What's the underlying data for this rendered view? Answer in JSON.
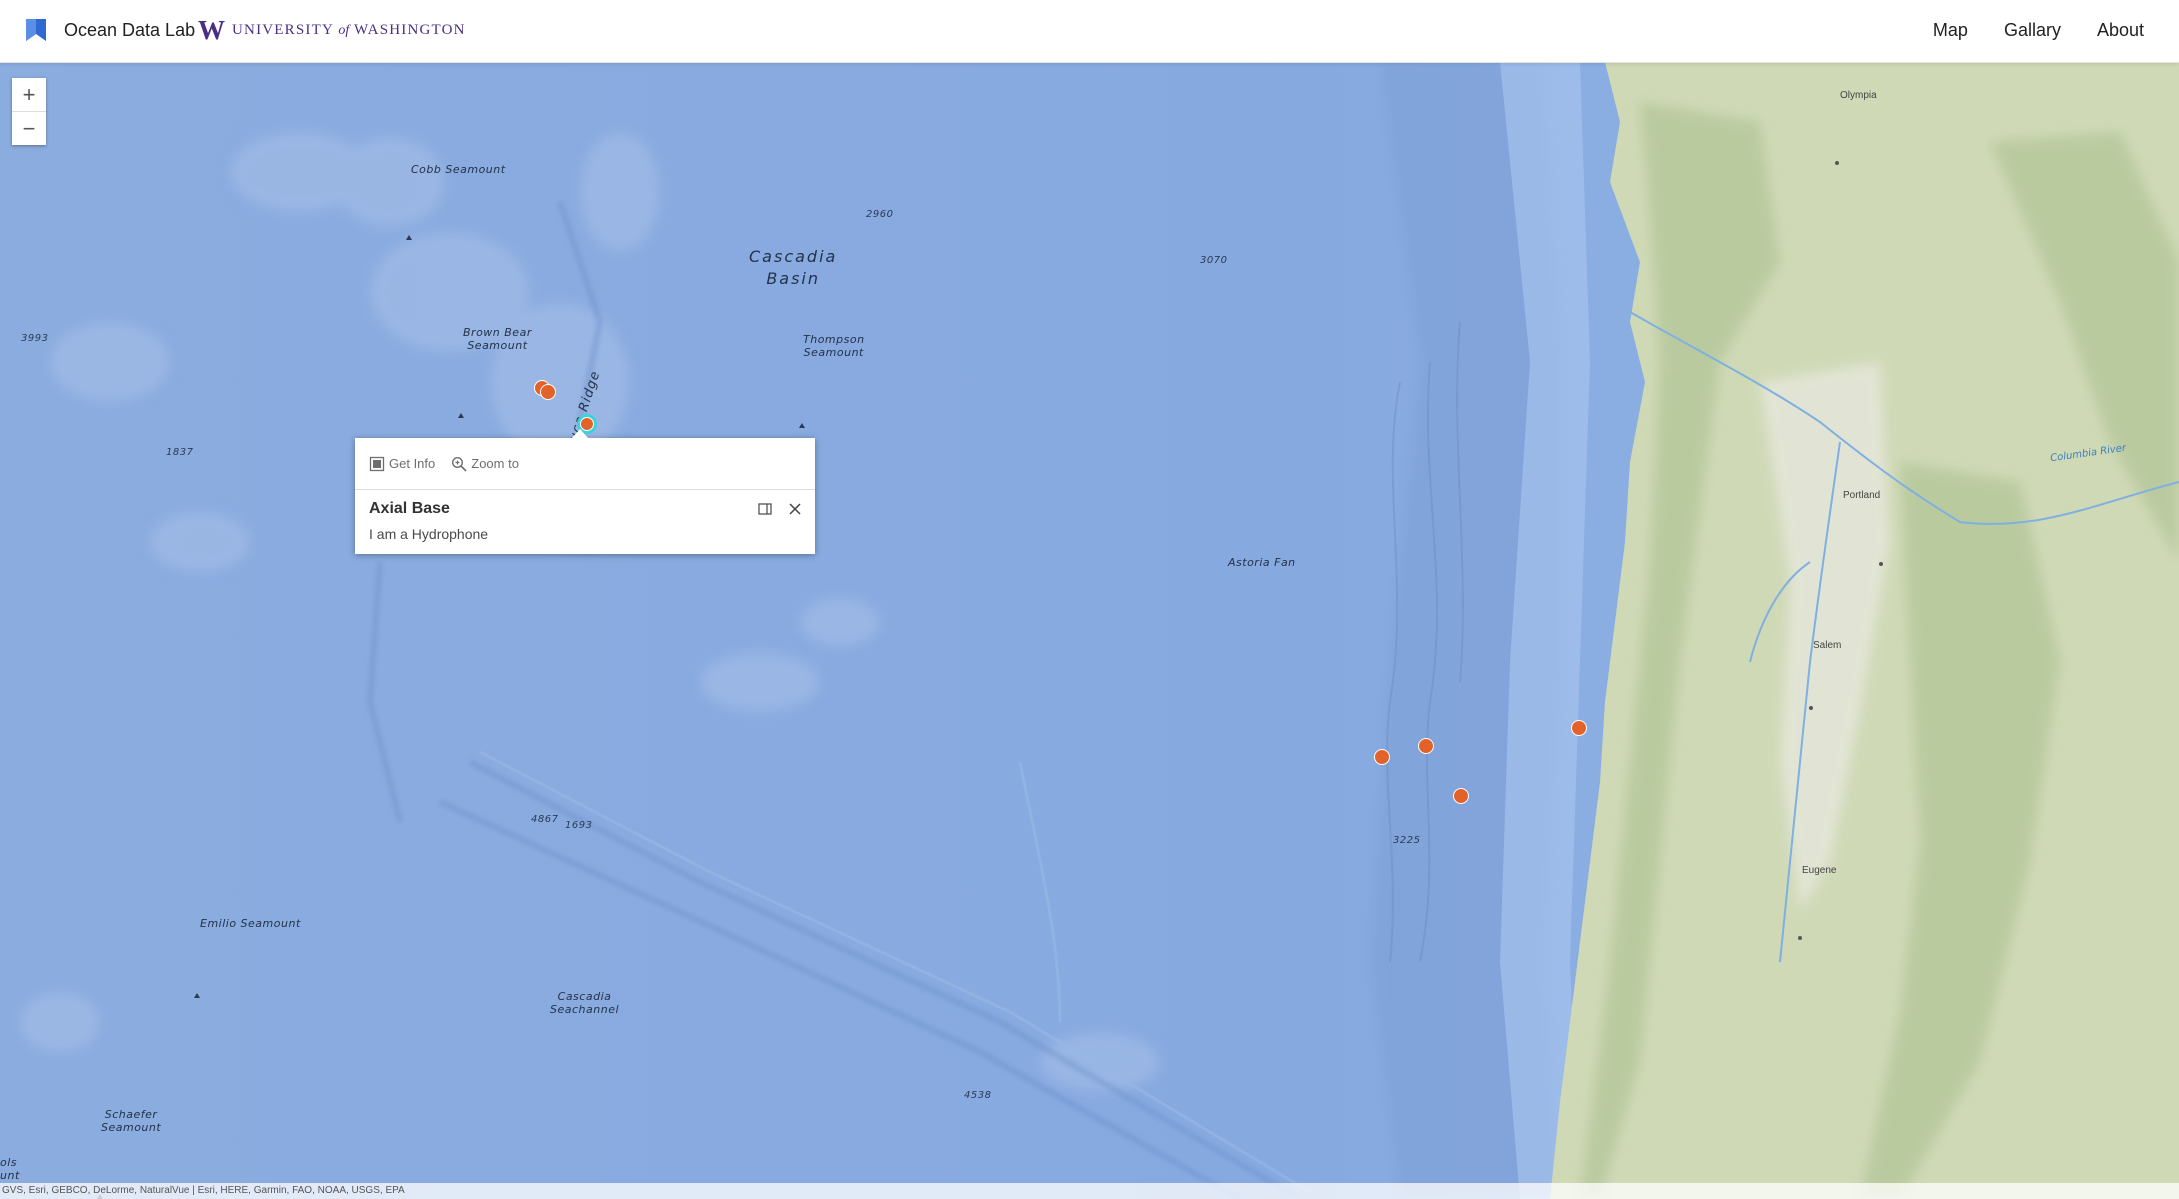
{
  "header": {
    "brand_name": "Ocean Data Lab",
    "uw_w": "W",
    "uw_university": "UNIVERSITY",
    "uw_of": "of",
    "uw_washington": "WASHINGTON",
    "nav": {
      "map": "Map",
      "gallery": "Gallary",
      "about": "About"
    }
  },
  "map": {
    "zoom_in": "+",
    "zoom_out": "−",
    "labels": {
      "cobb": "Cobb Seamount",
      "brown_bear_1": "Brown Bear",
      "brown_bear_2": "Seamount",
      "juan_de_fuca": "Juca Ridge",
      "cascadia_basin_1": "Cascadia",
      "cascadia_basin_2": "Basin",
      "thompson_1": "Thompson",
      "thompson_2": "Seamount",
      "astoria": "Astoria Fan",
      "emilio": "Emilio Seamount",
      "cascadia_sea_1": "Cascadia",
      "cascadia_sea_2": "Seachannel",
      "schaefer_1": "Schaefer",
      "schaefer_2": "Seamount",
      "edge_1": "ols",
      "edge_2": "unt"
    },
    "depths": {
      "d2960": "2960",
      "d3070": "3070",
      "d3993": "3993",
      "d1837": "1837",
      "d4867": "4867",
      "d1693": "1693",
      "d3225": "3225",
      "d4538": "4538"
    },
    "cities": {
      "olympia": "Olympia",
      "portland": "Portland",
      "salem": "Salem",
      "eugene": "Eugene"
    },
    "rivers": {
      "columbia": "Columbia River"
    },
    "attribution": "GVS, Esri, GEBCO, DeLorme, NaturalVue | Esri, HERE, Garmin, FAO, NOAA, USGS, EPA"
  },
  "popup": {
    "get_info": "Get Info",
    "zoom_to": "Zoom to",
    "title": "Axial Base",
    "body": "I am a Hydrophone"
  },
  "colors": {
    "marker": "#e2622a",
    "selected_ring": "#3bd3d8",
    "uw_purple": "#4b2e83",
    "ocean": "#8fb0e0",
    "land": "#cfd9b6"
  }
}
